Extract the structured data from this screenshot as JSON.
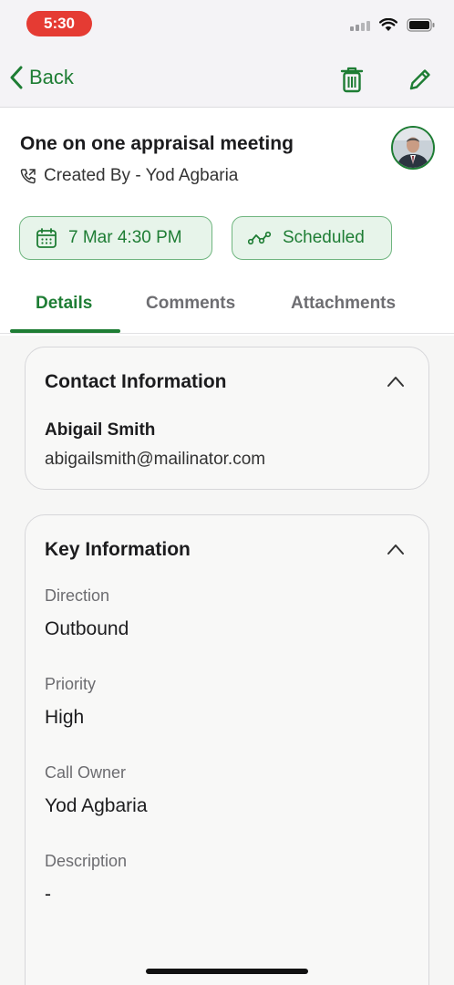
{
  "status_bar": {
    "time": "5:30"
  },
  "nav": {
    "back_label": "Back"
  },
  "header": {
    "title": "One on one appraisal meeting",
    "created_by": "Created By - Yod Agbaria"
  },
  "chips": {
    "date": "7 Mar 4:30 PM",
    "status": "Scheduled"
  },
  "tabs": [
    {
      "label": "Details",
      "active": true
    },
    {
      "label": "Comments",
      "active": false
    },
    {
      "label": "Attachments",
      "active": false
    }
  ],
  "contact_card": {
    "title": "Contact Information",
    "name": "Abigail Smith",
    "email": "abigailsmith@mailinator.com"
  },
  "key_card": {
    "title": "Key Information",
    "fields": [
      {
        "label": "Direction",
        "value": "Outbound"
      },
      {
        "label": "Priority",
        "value": "High"
      },
      {
        "label": "Call Owner",
        "value": "Yod Agbaria"
      },
      {
        "label": "Description",
        "value": "-"
      }
    ]
  },
  "colors": {
    "accent": "#1e7d34",
    "chip_bg": "#e7f4ea",
    "record_pill": "#e53b33"
  },
  "icons": [
    "wifi-icon",
    "battery-icon",
    "chevron-left-icon",
    "trash-icon",
    "pencil-icon",
    "call-icon",
    "calendar-icon",
    "status-icon",
    "chevron-up-icon"
  ]
}
